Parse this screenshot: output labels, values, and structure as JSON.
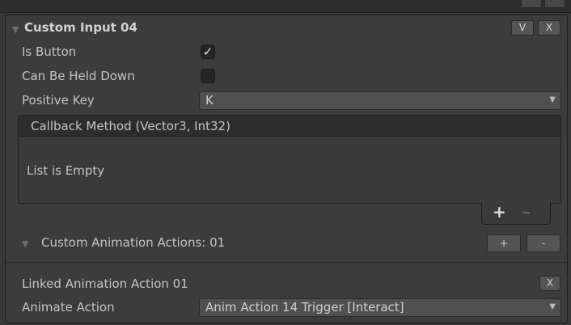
{
  "top_bar": {},
  "section": {
    "title": "Custom Input 04",
    "v_button": "V",
    "x_button": "X"
  },
  "fields": {
    "is_button": {
      "label": "Is Button",
      "checked": true
    },
    "can_be_held_down": {
      "label": "Can Be Held Down",
      "checked": false
    },
    "positive_key": {
      "label": "Positive Key",
      "value": "K"
    }
  },
  "callback": {
    "header": "Callback Method (Vector3, Int32)",
    "empty_text": "List is Empty",
    "add_label": "+",
    "remove_label": "–"
  },
  "animation_actions": {
    "title": "Custom Animation Actions: 01",
    "add_label": "+",
    "remove_label": "-"
  },
  "linked_action": {
    "title": "Linked Animation Action 01",
    "remove_label": "X",
    "animate_label": "Animate Action",
    "animate_value": "Anim Action 14 Trigger [Interact]"
  },
  "icons": {
    "foldout": "foldout-arrow-icon",
    "checkmark": "checkmark-icon",
    "dropdown": "dropdown-arrow-icon"
  },
  "colors": {
    "background": "#383838",
    "panel": "#3c3c3c",
    "header": "#2d2d2d",
    "dropdown": "#505050",
    "button": "#555555"
  }
}
